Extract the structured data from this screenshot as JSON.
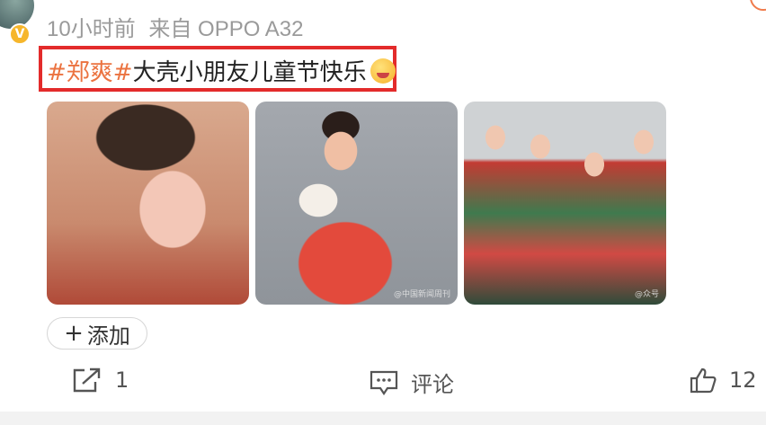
{
  "post": {
    "time": "10小时前",
    "source": "来自 OPPO A32",
    "hashtag": "#郑爽#",
    "text": "大壳小朋友儿童节快乐",
    "highlight_color": "#e32b2b",
    "hashtag_color": "#eb7340",
    "verified_badge": "V",
    "photos": [
      {
        "name": "childhood-photo-1"
      },
      {
        "name": "childhood-photo-2",
        "watermark": "@中国新闻周刊"
      },
      {
        "name": "childhood-photo-3",
        "watermark": "@众号"
      }
    ],
    "add_button": {
      "plus": "+",
      "label": "添加"
    }
  },
  "actions": {
    "share": {
      "icon": "share-icon",
      "count": "1"
    },
    "comment": {
      "icon": "comment-icon",
      "label": "评论"
    },
    "like": {
      "icon": "thumbs-up-icon",
      "count": "12"
    }
  }
}
